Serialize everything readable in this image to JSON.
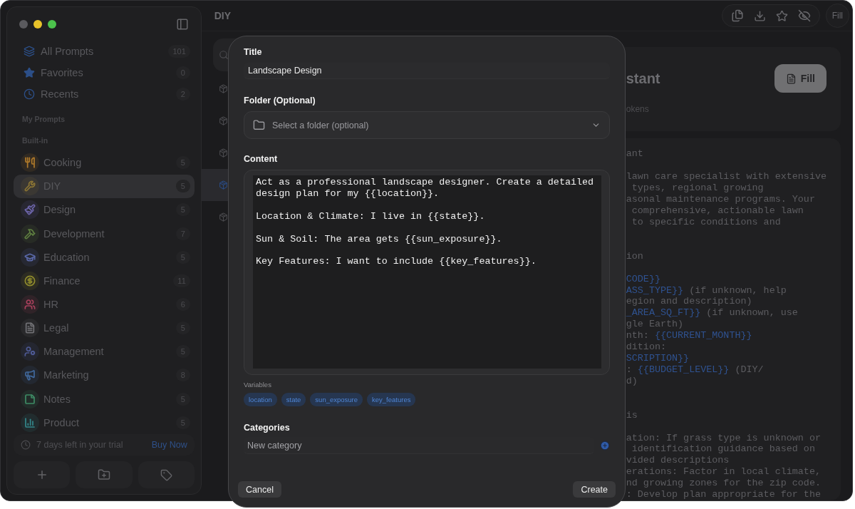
{
  "sidebar": {
    "nav": [
      {
        "label": "All Prompts",
        "count": "101"
      },
      {
        "label": "Favorites",
        "count": "0"
      },
      {
        "label": "Recents",
        "count": "2"
      }
    ],
    "section_my_prompts": "My Prompts",
    "section_builtin": "Built-in",
    "categories": [
      {
        "label": "Cooking",
        "count": "5",
        "color": "#b07a2a",
        "selected": false
      },
      {
        "label": "DIY",
        "count": "5",
        "color": "#8a7434",
        "selected": true
      },
      {
        "label": "Design",
        "count": "5",
        "color": "#6c64a8",
        "selected": false
      },
      {
        "label": "Development",
        "count": "7",
        "color": "#5e7e40",
        "selected": false
      },
      {
        "label": "Education",
        "count": "5",
        "color": "#5a68a8",
        "selected": false
      },
      {
        "label": "Finance",
        "count": "11",
        "color": "#8e8a2c",
        "selected": false
      },
      {
        "label": "HR",
        "count": "6",
        "color": "#a8405c",
        "selected": false
      },
      {
        "label": "Legal",
        "count": "5",
        "color": "#707074",
        "selected": false
      },
      {
        "label": "Management",
        "count": "5",
        "color": "#4e5a94",
        "selected": false
      },
      {
        "label": "Marketing",
        "count": "8",
        "color": "#40689c",
        "selected": false
      },
      {
        "label": "Notes",
        "count": "5",
        "color": "#3e8a64",
        "selected": false
      },
      {
        "label": "Product",
        "count": "5",
        "color": "#33868a",
        "selected": false
      }
    ],
    "trial": {
      "text": "7 days left in your trial",
      "link": "Buy Now"
    }
  },
  "header": {
    "title": "DIY",
    "fill_button": "Fill"
  },
  "prompt_list": [
    {
      "selected": false
    },
    {
      "selected": false
    },
    {
      "selected": false
    },
    {
      "selected": true
    },
    {
      "selected": false
    }
  ],
  "detail": {
    "title": "stant",
    "fill_button": "Fill",
    "meta": "okens",
    "paragraphs": [
      {
        "kind": "heading",
        "lines": [
          [
            {
              "text": "ant"
            }
          ]
        ]
      },
      {
        "kind": "body",
        "lines": [
          [
            {
              "text": "lawn care specialist with extensive"
            }
          ],
          [
            {
              "text": " types, regional growing"
            }
          ],
          [
            {
              "text": "asonal maintenance programs. Your"
            }
          ],
          [
            {
              "text": " comprehensive, actionable lawn"
            }
          ],
          [
            {
              "text": " to specific conditions and"
            }
          ]
        ]
      },
      {
        "kind": "heading",
        "lines": [
          [
            {
              "text": "ion"
            }
          ]
        ]
      },
      {
        "kind": "body",
        "lines": [
          [
            {
              "text": "CODE}}",
              "variable": true
            }
          ],
          [
            {
              "text": "ASS_TYPE}}",
              "variable": true
            },
            {
              "text": " (if unknown, help"
            }
          ],
          [
            {
              "text": "egion and description)"
            }
          ],
          [
            {
              "text": "_AREA_SQ_FT}}",
              "variable": true
            },
            {
              "text": " (if unknown, use"
            }
          ],
          [
            {
              "text": "gle Earth)"
            }
          ],
          [
            {
              "text": "nth: "
            },
            {
              "text": "{{CURRENT_MONTH}}",
              "variable": true
            }
          ],
          [
            {
              "text": "dition:"
            }
          ],
          [
            {
              "text": "SCRIPTION}}",
              "variable": true
            }
          ],
          [
            {
              "text": ": "
            },
            {
              "text": "{{BUDGET_LEVEL}}",
              "variable": true
            },
            {
              "text": " (DIY/"
            }
          ],
          [
            {
              "text": "d)"
            }
          ]
        ]
      },
      {
        "kind": "heading",
        "lines": [
          [
            {
              "text": "is"
            }
          ]
        ]
      },
      {
        "kind": "body",
        "lines": [
          [
            {
              "text": "ation: If grass type is unknown or"
            }
          ],
          [
            {
              "text": " identification guidance based on"
            }
          ],
          [
            {
              "text": "vided descriptions"
            }
          ],
          [
            {
              "text": "erations: Factor in local climate,"
            }
          ],
          [
            {
              "text": "nd growing zones for the zip code."
            }
          ],
          [
            {
              "text": ": Develop plan appropriate for the"
            }
          ]
        ]
      }
    ]
  },
  "modal": {
    "title_label": "Title",
    "title_value": "Landscape Design",
    "folder_label": "Folder (Optional)",
    "folder_placeholder": "Select a folder (optional)",
    "content_label": "Content",
    "content_value": "Act as a professional landscape designer. Create a detailed design plan for my {{location}}.\n\nLocation & Climate: I live in {{state}}.\n\nSun & Soil: The area gets {{sun_exposure}}.\n\nKey Features: I want to include {{key_features}}.",
    "variables_label": "Variables",
    "variables": [
      "location",
      "state",
      "sun_exposure",
      "key_features"
    ],
    "categories_label": "Categories",
    "category_placeholder": "New category",
    "cancel": "Cancel",
    "create": "Create"
  }
}
